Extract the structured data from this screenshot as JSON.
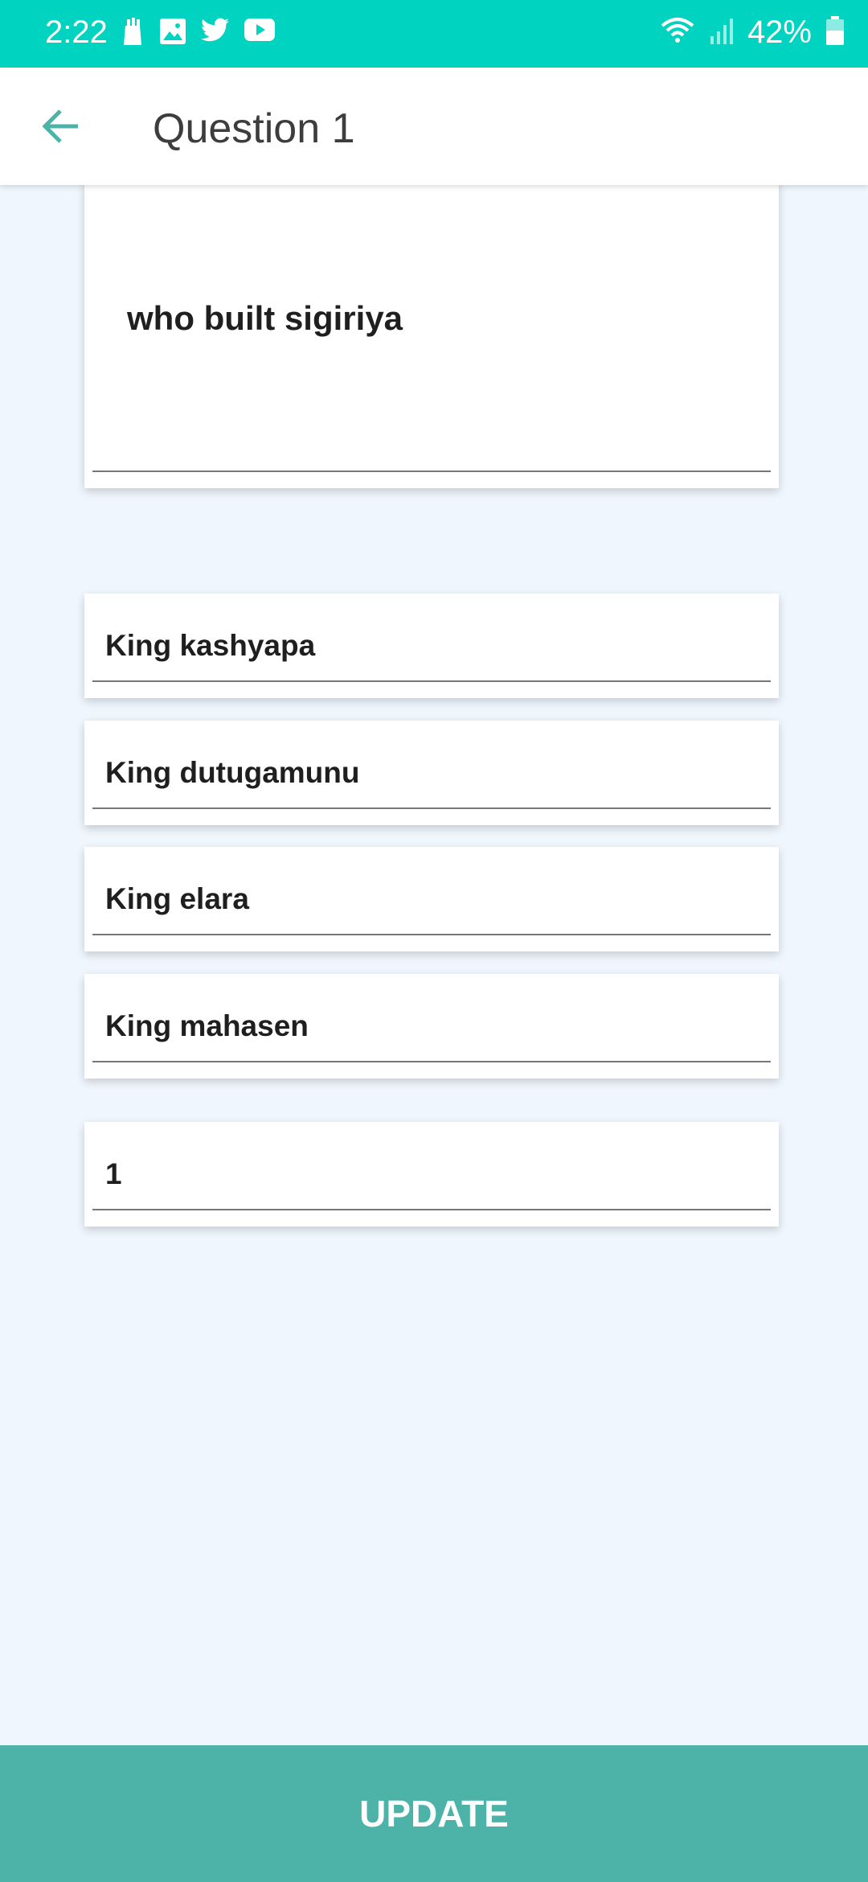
{
  "status_bar": {
    "time": "2:22",
    "battery": "42%",
    "icons_left": [
      "notification-icon",
      "gallery-icon",
      "twitter-icon",
      "youtube-icon"
    ],
    "icons_right": [
      "wifi-icon",
      "signal-icon",
      "battery-icon"
    ]
  },
  "app_bar": {
    "title": "Question 1",
    "back_icon": "arrow-back-icon"
  },
  "form": {
    "question": "who built sigiriya",
    "options": [
      "King kashyapa",
      "King dutugamunu",
      "King elara",
      "King mahasen"
    ],
    "answer": "1"
  },
  "update_button": {
    "label": "UPDATE"
  },
  "colors": {
    "status_bar": "#00d4c0",
    "accent": "#4db3a9",
    "background": "#eff6fd"
  }
}
